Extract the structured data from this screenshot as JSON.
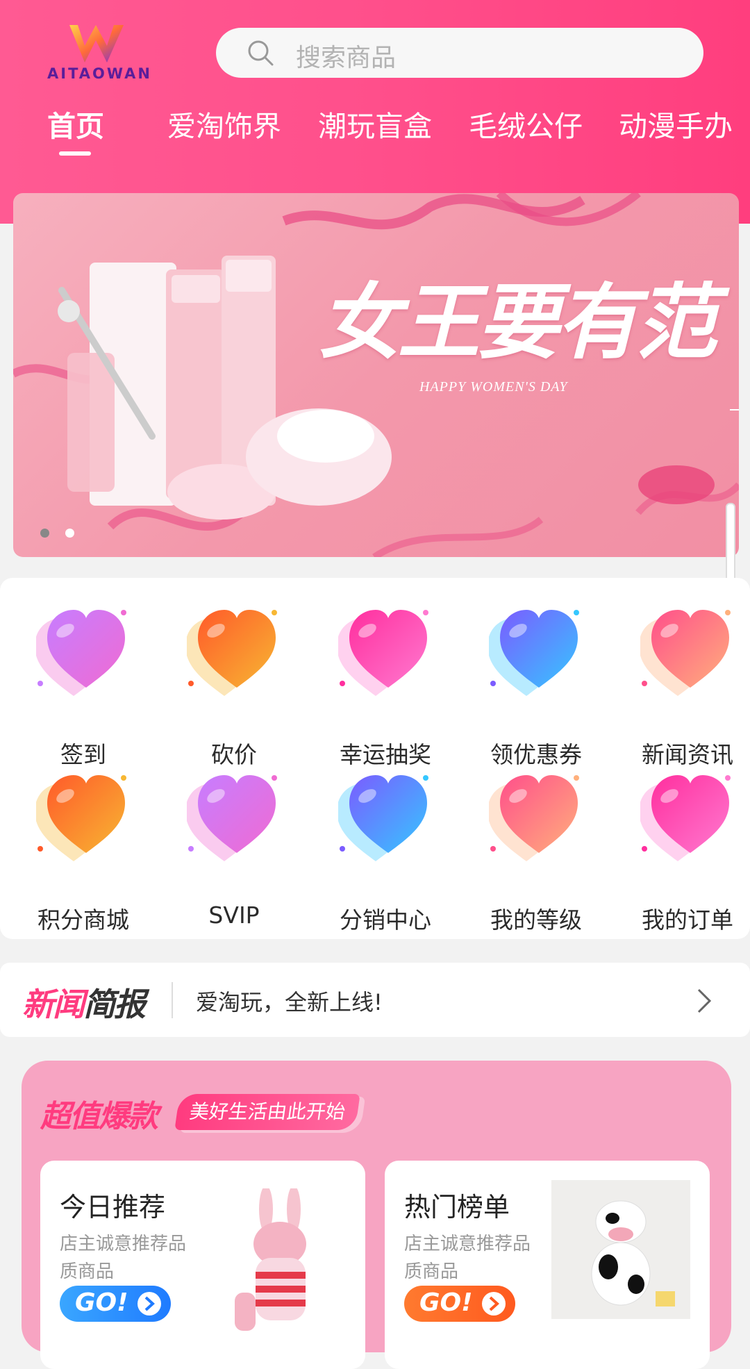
{
  "header": {
    "logo_text": "AITAOWAN",
    "search_placeholder": "搜索商品",
    "tabs": [
      {
        "label": "首页",
        "active": true
      },
      {
        "label": "爱淘饰界",
        "active": false
      },
      {
        "label": "潮玩盲盒",
        "active": false
      },
      {
        "label": "毛绒公仔",
        "active": false
      },
      {
        "label": "动漫手办",
        "active": false
      }
    ]
  },
  "banner": {
    "title": "女王要有范",
    "subtitle": "HAPPY WOMEN'S DAY",
    "dots": 2,
    "active_dot": 0
  },
  "grid": {
    "items": [
      {
        "label": "签到",
        "icon": "heart-purple-icon",
        "colors": [
          "#c77dff",
          "#f06bd2"
        ]
      },
      {
        "label": "砍价",
        "icon": "heart-orange-icon",
        "colors": [
          "#ff5a2a",
          "#f7b733"
        ]
      },
      {
        "label": "幸运抽奖",
        "icon": "heart-pink-icon",
        "colors": [
          "#ff2f9e",
          "#ff7ad0"
        ]
      },
      {
        "label": "领优惠券",
        "icon": "heart-blue-icon",
        "colors": [
          "#7b5cff",
          "#35c7ff"
        ]
      },
      {
        "label": "新闻资讯",
        "icon": "heart-coral-icon",
        "colors": [
          "#ff4f8b",
          "#ffb07c"
        ]
      },
      {
        "label": "积分商城",
        "icon": "heart-orange-icon",
        "colors": [
          "#ff5a2a",
          "#f7b733"
        ]
      },
      {
        "label": "SVIP",
        "icon": "heart-purple-icon",
        "colors": [
          "#c77dff",
          "#f06bd2"
        ]
      },
      {
        "label": "分销中心",
        "icon": "heart-blue-icon",
        "colors": [
          "#7b5cff",
          "#35c7ff"
        ]
      },
      {
        "label": "我的等级",
        "icon": "heart-coral-icon",
        "colors": [
          "#ff4f8b",
          "#ffb07c"
        ]
      },
      {
        "label": "我的订单",
        "icon": "heart-pink-icon",
        "colors": [
          "#ff2f9e",
          "#ff7ad0"
        ]
      }
    ]
  },
  "news": {
    "title_pink": "新闻",
    "title_dark": "简报",
    "text": "爱淘玩，全新上线!"
  },
  "promo": {
    "title": "超值爆款",
    "tag": "美好生活由此开始",
    "cards": [
      {
        "title": "今日推荐",
        "desc": "店主诚意推荐品质商品",
        "go": "GO!",
        "go_color": "#3aa6ff"
      },
      {
        "title": "热门榜单",
        "desc": "店主诚意推荐品质商品",
        "go": "GO!",
        "go_color": "#ff7a2f"
      }
    ]
  }
}
